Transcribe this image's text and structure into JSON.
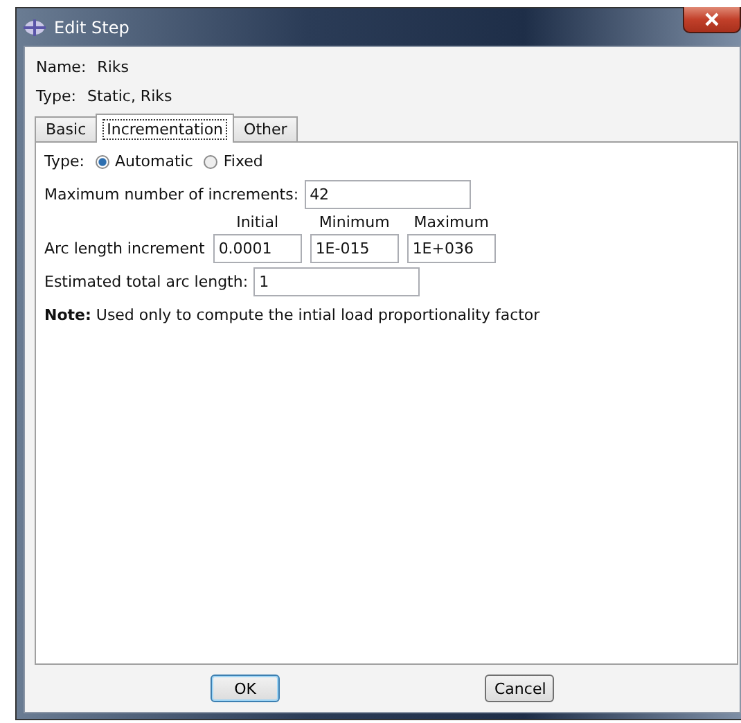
{
  "window": {
    "title": "Edit Step"
  },
  "name": {
    "label": "Name:",
    "value": "Riks"
  },
  "type": {
    "label": "Type:",
    "value": "Static, Riks"
  },
  "tabs": [
    {
      "label": "Basic",
      "selected": false
    },
    {
      "label": "Incrementation",
      "selected": true
    },
    {
      "label": "Other",
      "selected": false
    }
  ],
  "incrementation_type": {
    "label": "Type:",
    "options": [
      {
        "label": "Automatic",
        "selected": true
      },
      {
        "label": "Fixed",
        "selected": false
      }
    ]
  },
  "max_increments": {
    "label": "Maximum number of increments:",
    "value": "42"
  },
  "arc_length": {
    "columns": [
      "Initial",
      "Minimum",
      "Maximum"
    ],
    "label": "Arc length increment",
    "values": [
      "0.0001",
      "1E-015",
      "1E+036"
    ]
  },
  "total_arc_length": {
    "label": "Estimated total arc length:",
    "value": "1"
  },
  "note": "**Note:**  Used only to compute the intial load proportionality factor",
  "buttons": [
    "OK",
    "Cancel"
  ]
}
